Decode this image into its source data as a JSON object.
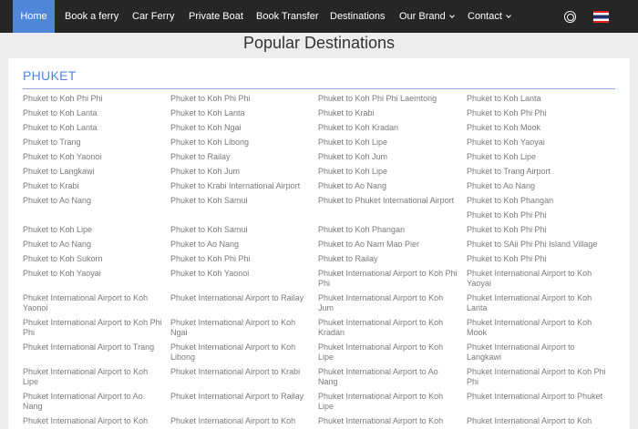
{
  "nav": {
    "items": [
      {
        "label": "Home",
        "active": true
      },
      {
        "label": "Book a ferry"
      },
      {
        "label": "Car Ferry"
      },
      {
        "label": "Private Boat"
      },
      {
        "label": "Book Transfer"
      },
      {
        "label": "Destinations"
      },
      {
        "label": "Our Brand",
        "has_dropdown": true
      },
      {
        "label": "Contact",
        "has_dropdown": true
      }
    ],
    "icons": [
      "support-icon",
      "thai-flag-icon"
    ],
    "colors": {
      "bar": "#262626",
      "active": "#4f86d9"
    }
  },
  "page": {
    "title": "Popular Destinations"
  },
  "region": {
    "title": "PHUKET",
    "accent": "#4f86d9"
  },
  "columns": [
    [
      "Phuket to Koh Phi Phi",
      "Phuket to Koh Lanta",
      "Phuket to Koh Lanta",
      "Phuket to Trang",
      "Phuket to Koh Yaonoi",
      "Phuket to Langkawi",
      "Phuket to Krabi",
      "Phuket to Ao Nang",
      "Phuket to Koh Lipe",
      "Phuket to Ao Nang",
      "Phuket to Koh Sukorn",
      "Phuket to Koh Yaoyai",
      "Phuket International Airport to Koh Yaonoi",
      "Phuket International Airport to Koh Phi Phi",
      "Phuket International Airport to Trang",
      "Phuket International Airport to Koh Lipe",
      "Phuket International Airport to Ao Nang",
      "Phuket International Airport to Koh"
    ],
    [
      "Phuket to Koh Phi Phi",
      "Phuket to Koh Lanta",
      "Phuket to Koh Ngai",
      "Phuket to Koh Libong",
      "Phuket to Railay",
      "Phuket to Koh Jum",
      "Phuket to Krabi International Airport",
      "Phuket to Koh Samui",
      "Phuket to Koh Samui",
      "Phuket to Ao Nang",
      "Phuket to Koh Phi Phi",
      "Phuket to Koh Yaonoi",
      "Phuket International Airport to Railay",
      "Phuket International Airport to Koh Ngai",
      "Phuket International Airport to Koh Libong",
      "Phuket International Airport to Krabi",
      "Phuket International Airport to Railay",
      "Phuket International Airport to Koh"
    ],
    [
      "Phuket to Koh Phi Phi Laemtong",
      "Phuket to Krabi",
      "Phuket to Koh Kradan",
      "Phuket to Koh Lipe",
      "Phuket to Koh Jum",
      "Phuket to Koh Lipe",
      "Phuket to Ao Nang",
      "Phuket to Phuket International Airport",
      "Phuket to Koh Phangan",
      "Phuket to Ao Nam Mao Pier",
      "Phuket to Railay",
      "Phuket International Airport to Koh Phi Phi",
      "Phuket International Airport to Koh Jum",
      "Phuket International Airport to Koh Kradan",
      "Phuket International Airport to Koh Lipe",
      "Phuket International Airport to Ao Nang",
      "Phuket International Airport to Koh Lipe",
      "Phuket International Airport to Koh"
    ],
    [
      "Phuket to Koh Lanta",
      "Phuket to Koh Phi Phi",
      "Phuket to Koh Mook",
      "Phuket to Koh Yaoyai",
      "Phuket to Koh Lipe",
      "Phuket to Trang Airport",
      "Phuket to Ao Nang",
      "Phuket to Koh Phangan",
      "Phuket to Koh Phi Phi",
      "Phuket to Koh Phi Phi",
      "Phuket to SAii Phi Phi Island Village",
      "Phuket to Koh Phi Phi",
      "Phuket International Airport to Koh Yaoyai",
      "Phuket International Airport to Koh Lanta",
      "Phuket International Airport to Koh Mook",
      "Phuket International Airport to Langkawi",
      "Phuket International Airport to Koh Phi Phi",
      "Phuket International Airport to Phuket",
      "Phuket International Airport to Koh"
    ]
  ]
}
